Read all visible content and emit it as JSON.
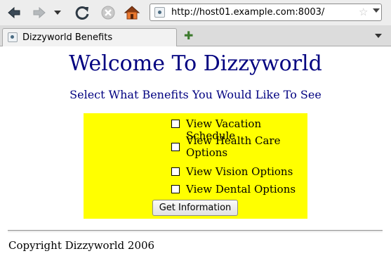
{
  "browser": {
    "url": "http://host01.example.com:8003/",
    "tab_title": "Dizzyworld Benefits",
    "new_tab_symbol": "✚",
    "bookmark_symbol": "☆"
  },
  "page": {
    "title": "Welcome To Dizzyworld",
    "subtitle": "Select What Benefits You Would Like To See",
    "options": [
      {
        "label": "View Vacation Schedule",
        "checked": false
      },
      {
        "label": "View Health Care Options",
        "checked": false
      },
      {
        "label": "View Vision Options",
        "checked": false
      },
      {
        "label": "View Dental Options",
        "checked": false
      }
    ],
    "submit_label": "Get Information",
    "footer": "Copyright Dizzyworld 2006"
  },
  "colors": {
    "heading": "#000080",
    "panel_background": "#ffff00"
  },
  "icons": {
    "back": "back-arrow-icon",
    "forward": "forward-arrow-icon",
    "reload": "reload-icon",
    "stop": "stop-icon",
    "home": "home-icon"
  }
}
